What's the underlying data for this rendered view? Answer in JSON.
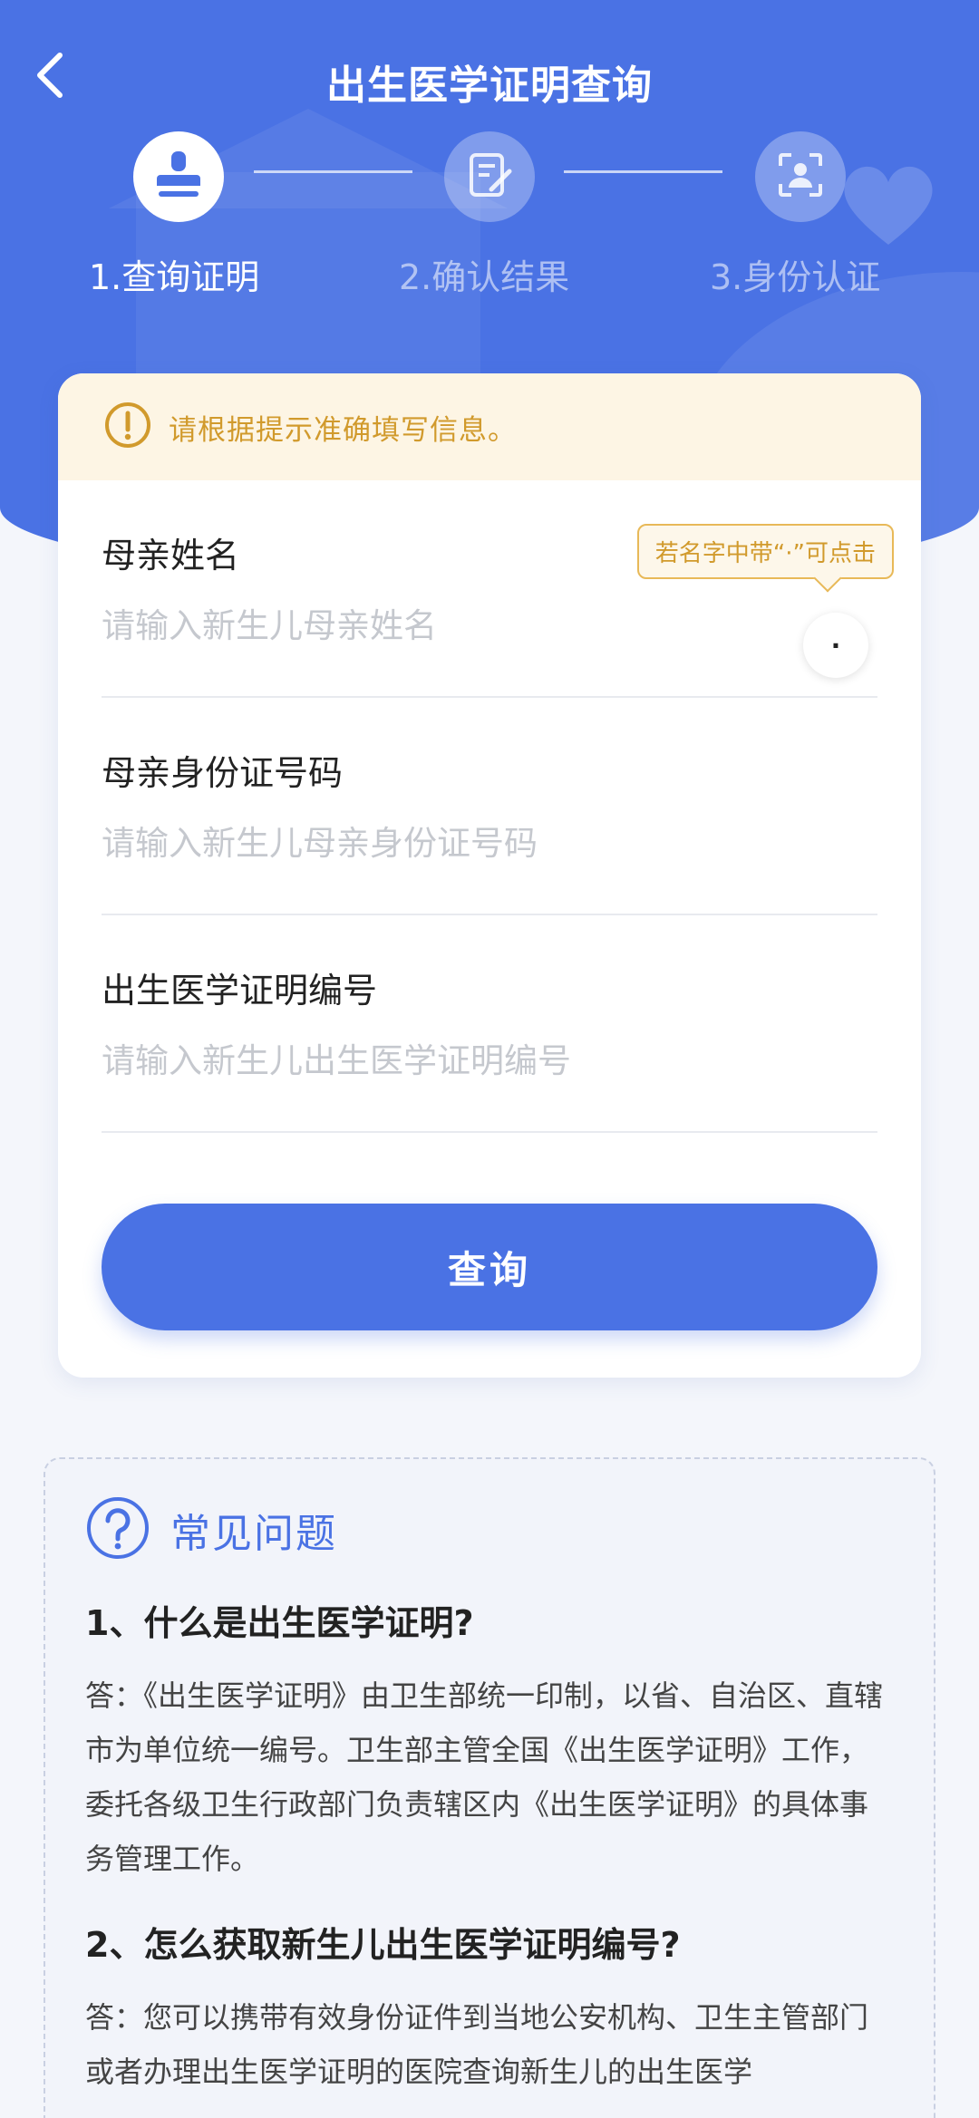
{
  "colors": {
    "primary": "#4a72e4",
    "notice_bg": "#fdf5e4",
    "notice_text": "#d19a2c",
    "page_bg": "#f4f6fb"
  },
  "header": {
    "title": "出生医学证明查询",
    "back_icon": "chevron-left-icon"
  },
  "steps": [
    {
      "label": "1.查询证明",
      "icon": "stamp-icon",
      "active": true
    },
    {
      "label": "2.确认结果",
      "icon": "edit-document-icon",
      "active": false
    },
    {
      "label": "3.身份认证",
      "icon": "face-scan-icon",
      "active": false
    }
  ],
  "notice": {
    "icon": "exclamation-circle-icon",
    "text": "请根据提示准确填写信息。"
  },
  "form": {
    "mother_name": {
      "label": "母亲姓名",
      "placeholder": "请输入新生儿母亲姓名",
      "value": ""
    },
    "name_tip": "若名字中带“·”可点击",
    "dot_button": "·",
    "mother_id": {
      "label": "母亲身份证号码",
      "placeholder": "请输入新生儿母亲身份证号码",
      "value": ""
    },
    "certificate_no": {
      "label": "出生医学证明编号",
      "placeholder": "请输入新生儿出生医学证明编号",
      "value": ""
    },
    "submit_label": "查询"
  },
  "faq": {
    "icon": "question-circle-icon",
    "title": "常见问题",
    "items": [
      {
        "question": "1、什么是出生医学证明?",
        "answer": "答：《出生医学证明》由卫生部统一印制，以省、自治区、直辖市为单位统一编号。卫生部主管全国《出生医学证明》工作，委托各级卫生行政部门负责辖区内《出生医学证明》的具体事务管理工作。"
      },
      {
        "question": "2、怎么获取新生儿出生医学证明编号?",
        "answer": "答：您可以携带有效身份证件到当地公安机构、卫生主管部门或者办理出生医学证明的医院查询新生儿的出生医学"
      }
    ]
  }
}
